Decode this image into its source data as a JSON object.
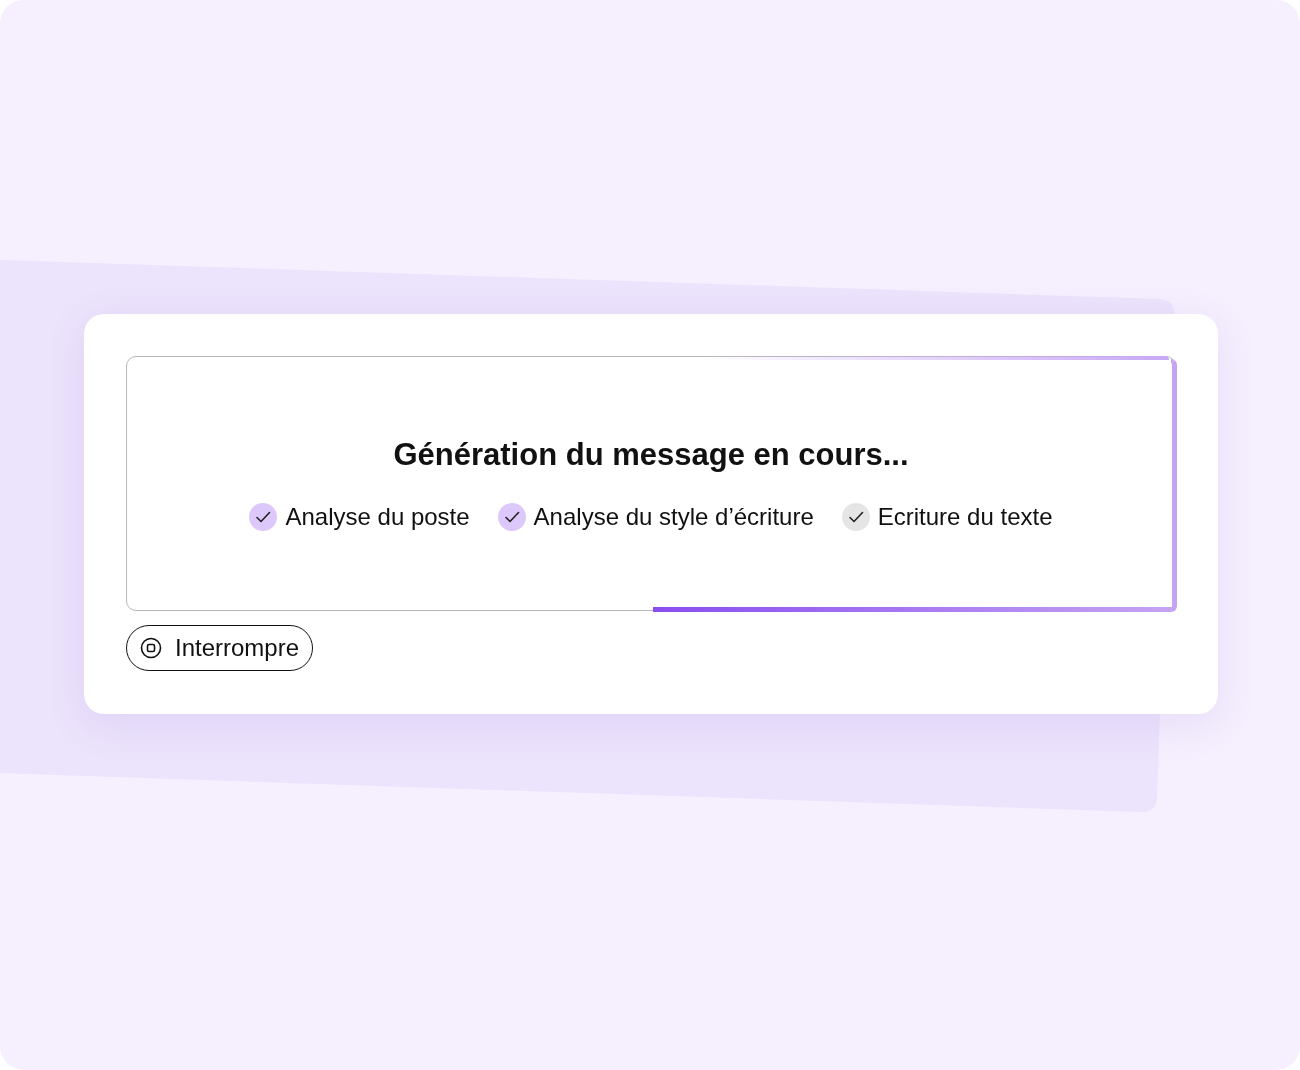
{
  "status": {
    "title": "Génération du message en cours...",
    "steps": [
      {
        "label": "Analyse du poste",
        "kind": "done"
      },
      {
        "label": "Analyse du style d’écriture",
        "kind": "done"
      },
      {
        "label": "Ecriture du texte",
        "kind": "pending"
      }
    ],
    "progress": {
      "level": 0.5
    }
  },
  "stop_button": {
    "label": "Interrompre"
  }
}
